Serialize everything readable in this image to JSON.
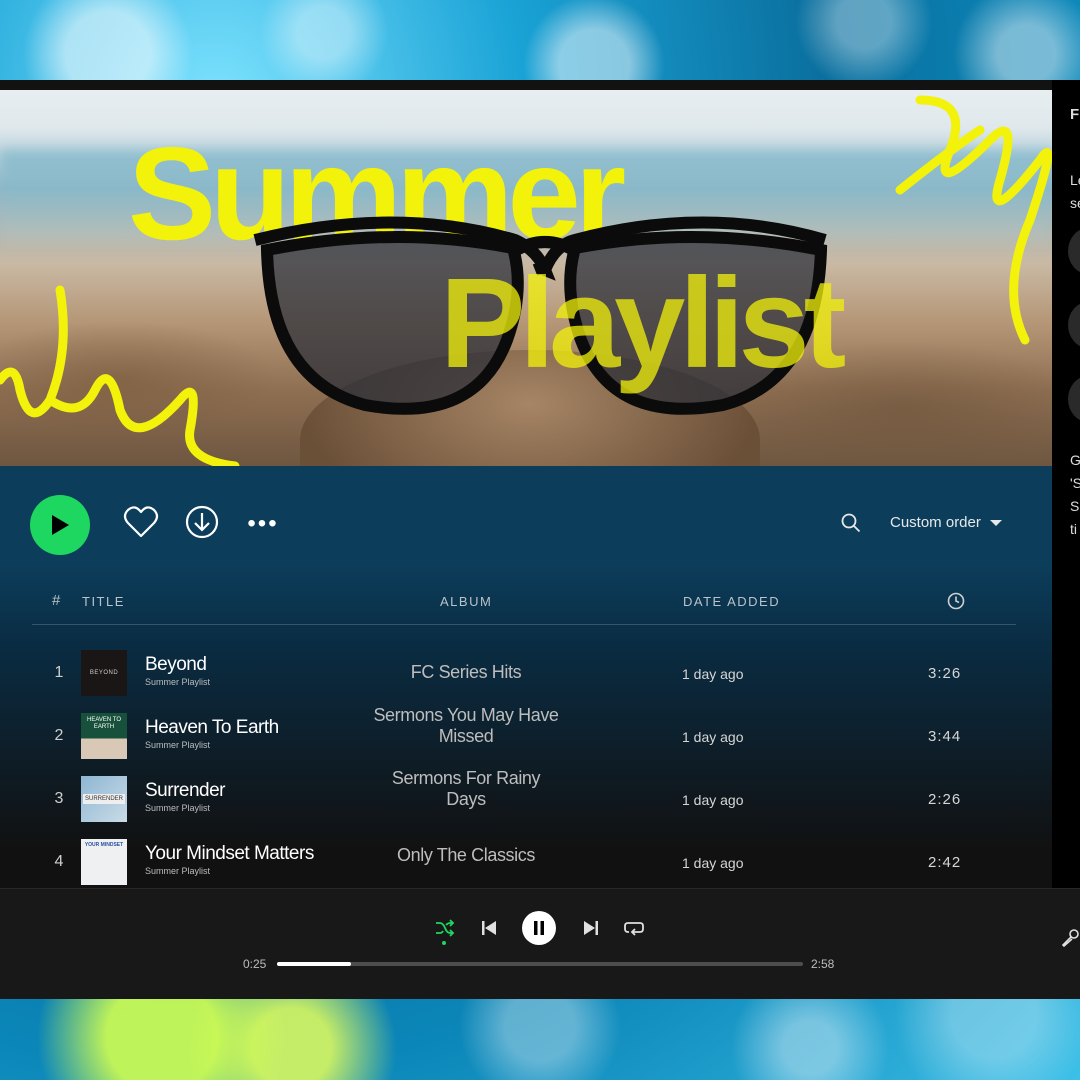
{
  "hero": {
    "line1": "Summer",
    "line2": "Playlist"
  },
  "controls": {
    "sort_label": "Custom order"
  },
  "table": {
    "headers": {
      "num": "#",
      "title": "TITLE",
      "album": "ALBUM",
      "date": "DATE ADDED"
    },
    "tracks": [
      {
        "num": "1",
        "title": "Beyond",
        "artist": "Summer Playlist",
        "album": "FC Series Hits",
        "date": "1 day ago",
        "duration": "3:26",
        "cover_text": "BEYOND"
      },
      {
        "num": "2",
        "title": "Heaven To Earth",
        "artist": "Summer Playlist",
        "album": "Sermons You May Have Missed",
        "date": "1 day ago",
        "duration": "3:44",
        "cover_text": "HEAVEN TO EARTH"
      },
      {
        "num": "3",
        "title": "Surrender",
        "artist": "Summer Playlist",
        "album": "Sermons For Rainy Days",
        "date": "1 day ago",
        "duration": "2:26",
        "cover_text": "SURRENDER"
      },
      {
        "num": "4",
        "title": "Your Mindset Matters",
        "artist": "Summer Playlist",
        "album": "Only The Classics",
        "date": "1 day ago",
        "duration": "2:42",
        "cover_text": "YOUR MINDSET"
      }
    ]
  },
  "right_panel": {
    "lines": [
      "Fr",
      "Le",
      "se",
      "G",
      "'S",
      "Sp",
      "ti"
    ]
  },
  "player": {
    "elapsed": "0:25",
    "total": "2:58",
    "progress": 0.14
  },
  "colors": {
    "accent_green": "#1ed760",
    "hero_yellow": "#f2f20a"
  }
}
